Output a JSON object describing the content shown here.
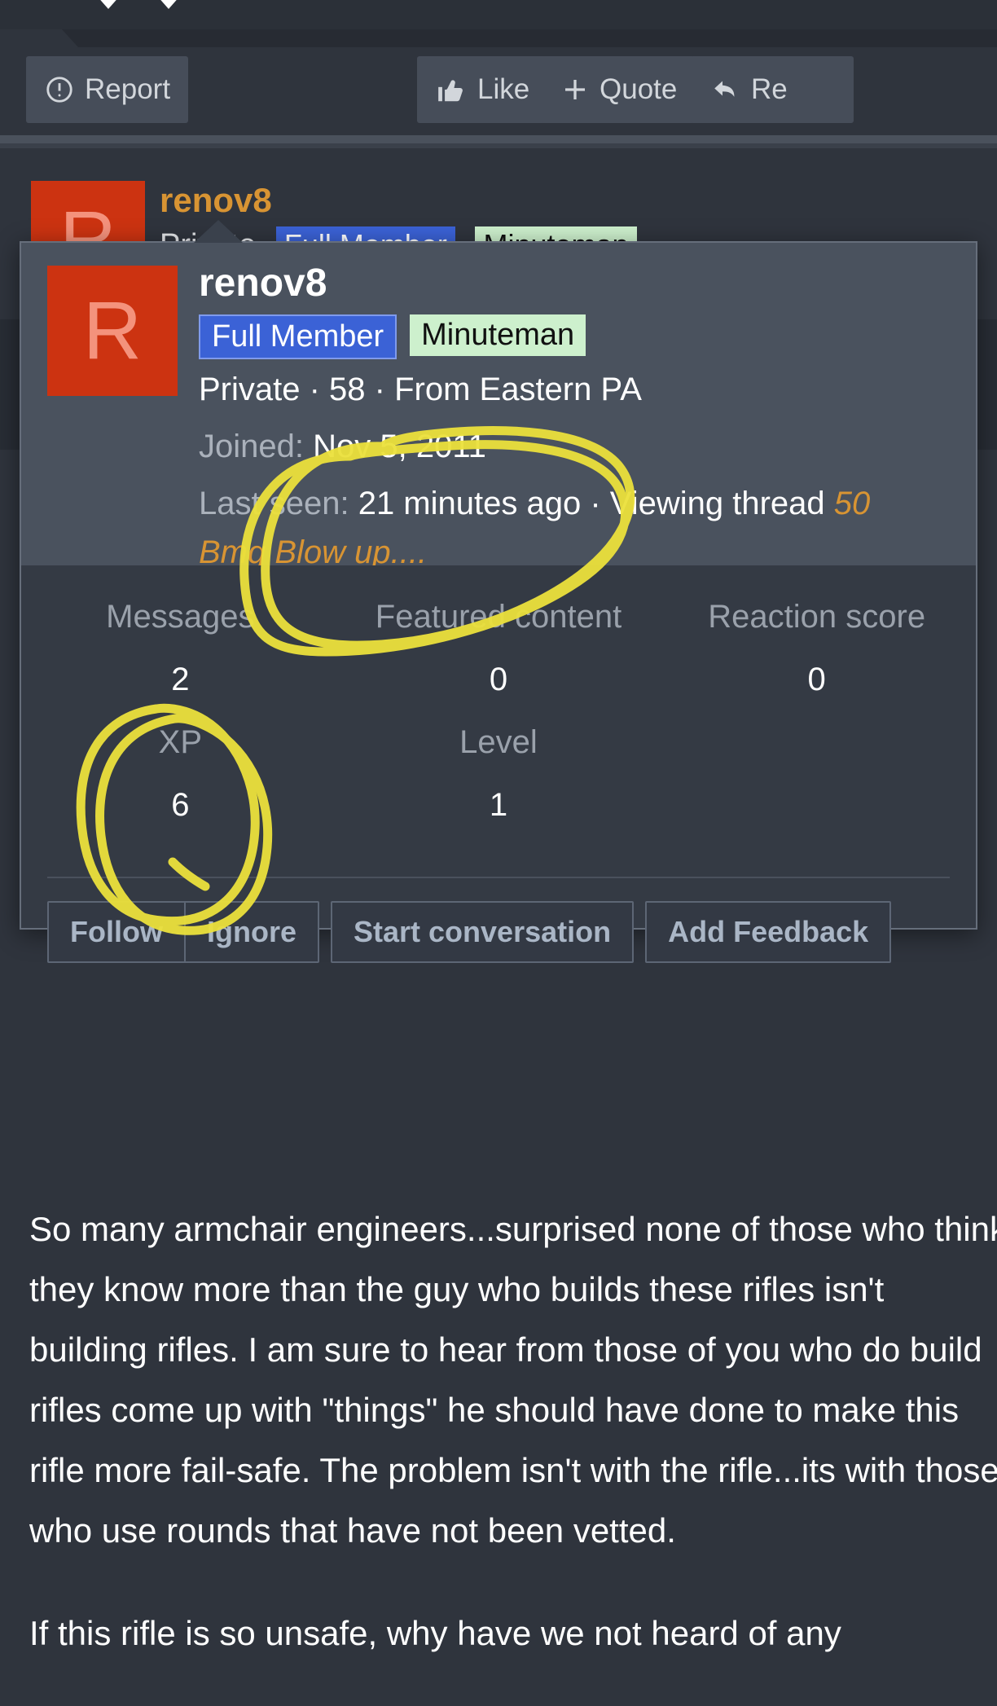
{
  "toolbar": {
    "report_label": "Report",
    "like_label": "Like",
    "quote_label": "Quote",
    "reply_label": "Re",
    "report_icon": "exclamation-circle-icon",
    "like_icon": "thumbs-up-icon",
    "quote_icon": "plus-icon",
    "reply_icon": "reply-arrow-icon"
  },
  "post": {
    "avatar_initial": "R",
    "username": "renov8",
    "line2_prefix": "Private",
    "badge_full_member": "Full Member",
    "badge_minuteman": "Minuteman"
  },
  "card": {
    "avatar_initial": "R",
    "username": "renov8",
    "badges": [
      {
        "label": "Full Member",
        "color": "#3b62d6"
      },
      {
        "label": "Minuteman",
        "color": "#cdf0cd"
      }
    ],
    "location_line": "Private · 58 · From Eastern PA",
    "joined_label": "Joined:",
    "joined_value": "Nov 5, 2011",
    "last_seen_label": "Last seen:",
    "last_seen_value": "21 minutes ago · Viewing thread",
    "viewing_thread_1": "50",
    "viewing_thread_2": "Bmg Blow up....",
    "stats": [
      {
        "label": "Messages",
        "value": "2"
      },
      {
        "label": "Featured content",
        "value": "0"
      },
      {
        "label": "Reaction score",
        "value": "0"
      },
      {
        "label": "XP",
        "value": "6"
      },
      {
        "label": "Level",
        "value": "1"
      }
    ],
    "actions": [
      "Follow",
      "Ignore",
      "Start conversation",
      "Add Feedback"
    ]
  },
  "body": {
    "paragraph1": "So many armchair engineers...surprised none of those who think they know more than the guy who builds these rifles isn't building rifles. I am sure to hear from those of you who do build rifles come up with \"things\" he should have done to make this rifle more fail-safe. The problem isn't with the rifle...its with those who use rounds that have not been vetted.",
    "paragraph2": "If this rifle is so unsafe, why have we not heard of any"
  },
  "colors": {
    "page_background": "#2f343d",
    "card_background": "#3a414c",
    "card_body_background": "#343a44",
    "accent_orange": "#d89433",
    "avatar_red": "#cc3311",
    "badge_blue": "#3b62d6",
    "badge_green": "#cdf0cd",
    "annotation_yellow": "#ece13c"
  }
}
